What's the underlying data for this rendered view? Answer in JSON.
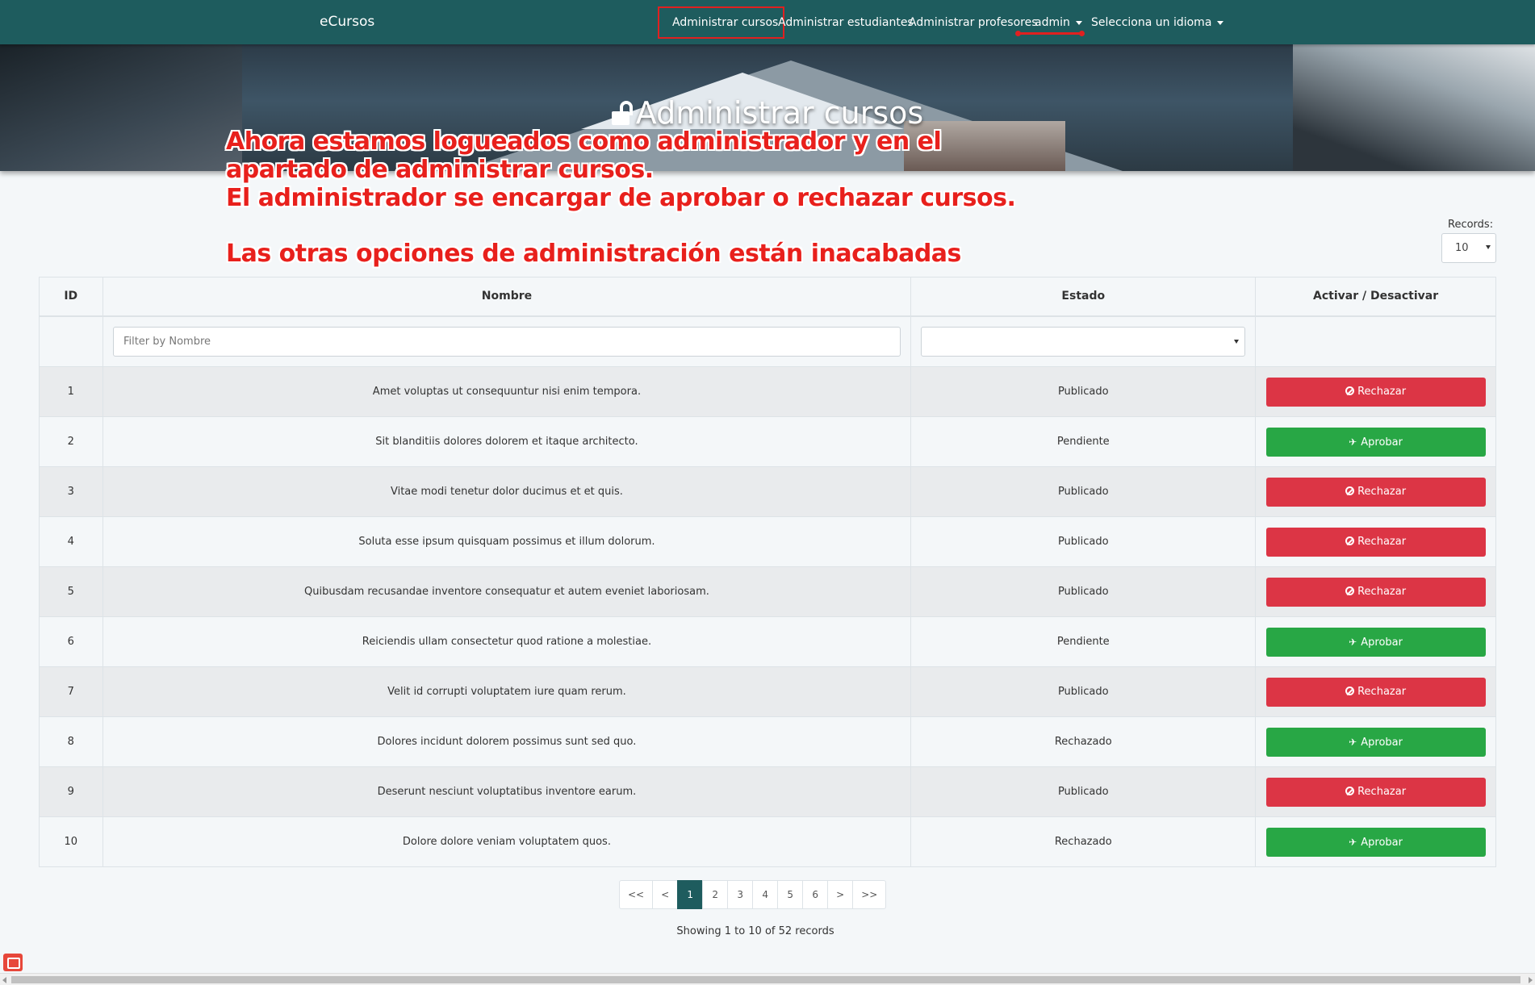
{
  "navbar": {
    "brand": "eCursos",
    "items": [
      {
        "label": "Administrar cursos"
      },
      {
        "label": "Administrar estudiantes"
      },
      {
        "label": "Administrar profesores"
      },
      {
        "label": "admin"
      },
      {
        "label": "Selecciona un idioma"
      }
    ]
  },
  "hero": {
    "title": "Administrar cursos",
    "icon": "unlock-icon"
  },
  "annotation": {
    "lines": [
      "Ahora estamos logueados como administrador y en el",
      "apartado de administrar cursos.",
      "El administrador se encargar de aprobar o rechazar cursos.",
      "Las otras opciones de administración están inacabadas"
    ],
    "color": "#e8201c"
  },
  "records": {
    "label": "Records:",
    "value": "10"
  },
  "table": {
    "headers": [
      "ID",
      "Nombre",
      "Estado",
      "Activar / Desactivar"
    ],
    "filter": {
      "placeholder": "Filter by Nombre",
      "value": ""
    },
    "rows": [
      {
        "id": "1",
        "nombre": "Amet voluptas ut consequuntur nisi enim tempora.",
        "estado": "Publicado",
        "action": "Rechazar"
      },
      {
        "id": "2",
        "nombre": "Sit blanditiis dolores dolorem et itaque architecto.",
        "estado": "Pendiente",
        "action": "Aprobar"
      },
      {
        "id": "3",
        "nombre": "Vitae modi tenetur dolor ducimus et et quis.",
        "estado": "Publicado",
        "action": "Rechazar"
      },
      {
        "id": "4",
        "nombre": "Soluta esse ipsum quisquam possimus et illum dolorum.",
        "estado": "Publicado",
        "action": "Rechazar"
      },
      {
        "id": "5",
        "nombre": "Quibusdam recusandae inventore consequatur et autem eveniet laboriosam.",
        "estado": "Publicado",
        "action": "Rechazar"
      },
      {
        "id": "6",
        "nombre": "Reiciendis ullam consectetur quod ratione a molestiae.",
        "estado": "Pendiente",
        "action": "Aprobar"
      },
      {
        "id": "7",
        "nombre": "Velit id corrupti voluptatem iure quam rerum.",
        "estado": "Publicado",
        "action": "Rechazar"
      },
      {
        "id": "8",
        "nombre": "Dolores incidunt dolorem possimus sunt sed quo.",
        "estado": "Rechazado",
        "action": "Aprobar"
      },
      {
        "id": "9",
        "nombre": "Deserunt nesciunt voluptatibus inventore earum.",
        "estado": "Publicado",
        "action": "Rechazar"
      },
      {
        "id": "10",
        "nombre": "Dolore dolore veniam voluptatem quos.",
        "estado": "Rechazado",
        "action": "Aprobar"
      }
    ]
  },
  "pagination": {
    "items": [
      "<<",
      "<",
      "1",
      "2",
      "3",
      "4",
      "5",
      "6",
      ">",
      ">>"
    ],
    "active": "1",
    "summary": "Showing 1 to 10 of 52 records"
  },
  "colors": {
    "primary": "#1e5c5e",
    "danger": "#dc3545",
    "success": "#28a745"
  }
}
